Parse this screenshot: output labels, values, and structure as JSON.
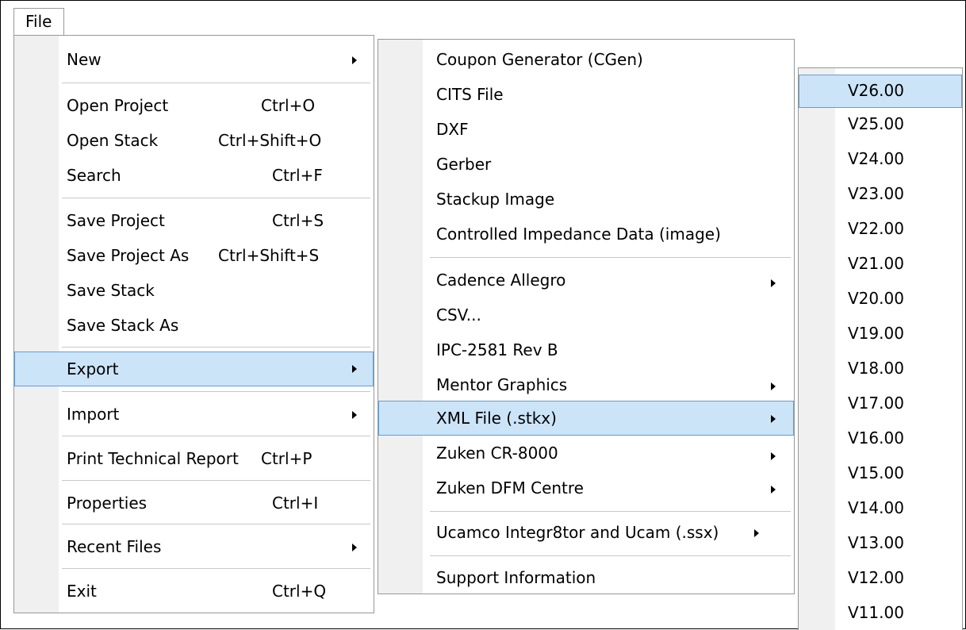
{
  "menubar": {
    "file_label": "File"
  },
  "file_menu": {
    "new": "New",
    "open_project": "Open Project",
    "open_project_sc": "Ctrl+O",
    "open_stack": "Open Stack",
    "open_stack_sc": "Ctrl+Shift+O",
    "search": "Search",
    "search_sc": "Ctrl+F",
    "save_project": "Save Project",
    "save_project_sc": "Ctrl+S",
    "save_project_as": "Save Project As",
    "save_project_as_sc": "Ctrl+Shift+S",
    "save_stack": "Save Stack",
    "save_stack_as": "Save Stack As",
    "export": "Export",
    "import": "Import",
    "print_report": "Print Technical Report",
    "print_report_sc": "Ctrl+P",
    "properties": "Properties",
    "properties_sc": "Ctrl+I",
    "recent_files": "Recent Files",
    "exit": "Exit",
    "exit_sc": "Ctrl+Q"
  },
  "export_menu": {
    "coupon_generator": "Coupon Generator (CGen)",
    "cits_file": "CITS File",
    "dxf": "DXF",
    "gerber": "Gerber",
    "stackup_image": "Stackup Image",
    "controlled_impedance": "Controlled Impedance Data (image)",
    "cadence_allegro": "Cadence Allegro",
    "csv": "CSV...",
    "ipc_2581": "IPC-2581 Rev B",
    "mentor_graphics": "Mentor Graphics",
    "xml_file": "XML File (.stkx)",
    "zuken_cr8000": "Zuken CR-8000",
    "zuken_dfm": "Zuken DFM Centre",
    "ucamco": "Ucamco Integr8tor and Ucam (.ssx)",
    "support_info": "Support Information"
  },
  "version_menu": {
    "versions": [
      "V26.00",
      "V25.00",
      "V24.00",
      "V23.00",
      "V22.00",
      "V21.00",
      "V20.00",
      "V19.00",
      "V18.00",
      "V17.00",
      "V16.00",
      "V15.00",
      "V14.00",
      "V13.00",
      "V12.00",
      "V11.00"
    ]
  },
  "colors": {
    "highlight_bg": "#cce4f7",
    "highlight_border": "#5ea0d6",
    "gutter": "#f0f0f0"
  }
}
